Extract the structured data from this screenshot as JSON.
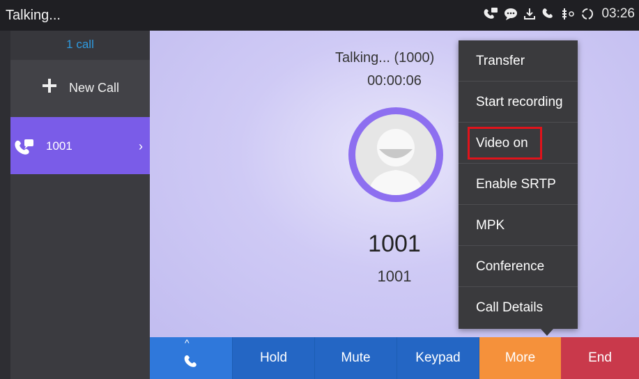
{
  "status_bar": {
    "title": "Talking...",
    "time": "03:26",
    "icons": [
      "voicemail-icon",
      "message-icon",
      "download-icon",
      "phone-icon",
      "usb-icon",
      "sync-icon"
    ]
  },
  "sidebar": {
    "call_count": "1 call",
    "new_call_label": "New Call",
    "active_call_label": "1001",
    "active_call_chevron": "›"
  },
  "call": {
    "status": "Talking... (1000)",
    "timer": "00:00:06",
    "callee_name": "1001",
    "callee_number": "1001"
  },
  "bottom_bar": {
    "hold": "Hold",
    "mute": "Mute",
    "keypad": "Keypad",
    "more": "More",
    "end": "End",
    "caret": "^"
  },
  "menu": {
    "items": [
      "Transfer",
      "Start recording",
      "Video on",
      "Enable SRTP",
      "MPK",
      "Conference",
      "Call Details"
    ]
  },
  "colors": {
    "accent_purple": "#7a5ce8",
    "blue_button": "#2466c4",
    "more_orange": "#f5913b",
    "end_red": "#c9394b",
    "highlight_red": "#e0131b"
  }
}
